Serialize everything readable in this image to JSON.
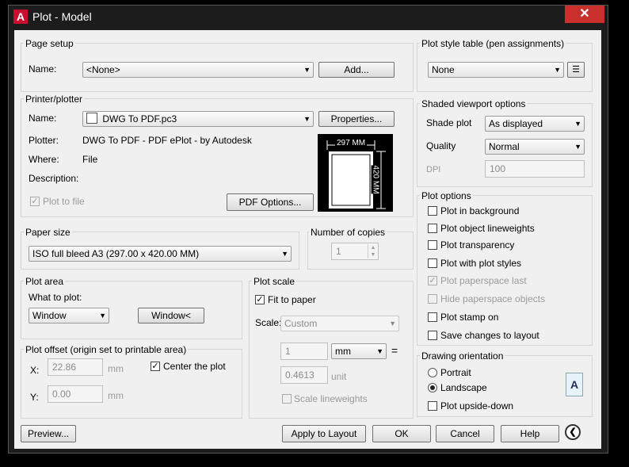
{
  "window": {
    "title": "Plot - Model",
    "logo": "A",
    "close": "✕"
  },
  "page_setup": {
    "group": "Page setup",
    "name_label": "Name:",
    "name_value": "<None>",
    "add_button": "Add..."
  },
  "printer": {
    "group": "Printer/plotter",
    "name_label": "Name:",
    "name_value": "DWG To PDF.pc3",
    "properties_button": "Properties...",
    "plotter_label": "Plotter:",
    "plotter_value": "DWG To PDF - PDF ePlot - by Autodesk",
    "where_label": "Where:",
    "where_value": "File",
    "description_label": "Description:",
    "plot_to_file": "Plot to file",
    "pdf_options_button": "PDF Options...",
    "preview_width": "297 MM",
    "preview_height": "420 MM"
  },
  "paper_size": {
    "group": "Paper size",
    "value": "ISO full bleed A3 (297.00 x 420.00 MM)"
  },
  "copies": {
    "group": "Number of copies",
    "value": "1"
  },
  "plot_area": {
    "group": "Plot area",
    "what_label": "What to plot:",
    "value": "Window",
    "window_button": "Window<"
  },
  "plot_offset": {
    "group": "Plot offset (origin set to printable area)",
    "x_label": "X:",
    "x_value": "22.86",
    "x_unit": "mm",
    "y_label": "Y:",
    "y_value": "0.00",
    "y_unit": "mm",
    "center_label": "Center the plot"
  },
  "plot_scale": {
    "group": "Plot scale",
    "fit_label": "Fit to paper",
    "scale_label": "Scale:",
    "scale_value": "Custom",
    "value1": "1",
    "unit1": "mm",
    "equals": "=",
    "value2": "0.4613",
    "unit2": "unit",
    "lineweights": "Scale lineweights"
  },
  "style_table": {
    "group": "Plot style table (pen assignments)",
    "value": "None"
  },
  "shaded": {
    "group": "Shaded viewport options",
    "shade_label": "Shade plot",
    "shade_value": "As displayed",
    "quality_label": "Quality",
    "quality_value": "Normal",
    "dpi_label": "DPI",
    "dpi_value": "100"
  },
  "plot_options": {
    "group": "Plot options",
    "items": [
      "Plot in background",
      "Plot object lineweights",
      "Plot transparency",
      "Plot with plot styles",
      "Plot paperspace last",
      "Hide paperspace objects",
      "Plot stamp on",
      "Save changes to layout"
    ]
  },
  "orientation": {
    "group": "Drawing orientation",
    "portrait": "Portrait",
    "landscape": "Landscape",
    "upside": "Plot upside-down",
    "icon_letter": "A"
  },
  "footer": {
    "preview": "Preview...",
    "apply": "Apply to Layout",
    "ok": "OK",
    "cancel": "Cancel",
    "help": "Help",
    "collapse": "❮"
  }
}
